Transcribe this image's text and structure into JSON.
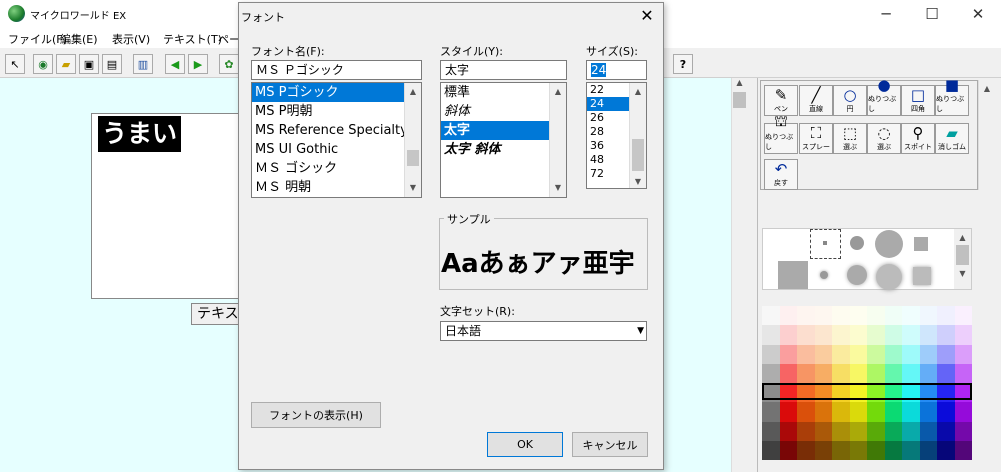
{
  "app": {
    "title": "マイクロワールド EX",
    "window_controls": {
      "minimize": "─",
      "maximize": "☐",
      "close": "✕"
    },
    "menus": [
      "ファイル(F)",
      "編集(E)",
      "表示(V)",
      "テキスト(T)",
      "ペー"
    ]
  },
  "canvas": {
    "selected_text": "うまい",
    "text_button": "テキス"
  },
  "toolbar": {
    "icons": [
      "pointer-icon",
      "globe-icon",
      "open-folder-icon",
      "save-icon",
      "print-icon",
      "book-icon",
      "prev-page-icon",
      "next-page-icon",
      "turtle-icon",
      "help-icon"
    ],
    "help_label": "?"
  },
  "paint_tools": [
    {
      "label": "ペン",
      "icon": "pen-icon"
    },
    {
      "label": "直線",
      "icon": "line-icon"
    },
    {
      "label": "円",
      "icon": "circle-icon"
    },
    {
      "label": "ぬりつぶし",
      "icon": "filled-circle-icon"
    },
    {
      "label": "四角",
      "icon": "rectangle-icon"
    },
    {
      "label": "ぬりつぶし",
      "icon": "filled-rectangle-icon"
    },
    {
      "label": "ぬりつぶし",
      "icon": "bucket-icon"
    },
    {
      "label": "スプレー",
      "icon": "spray-icon"
    },
    {
      "label": "選ぶ",
      "icon": "select-rect-icon"
    },
    {
      "label": "選ぶ",
      "icon": "lasso-icon"
    },
    {
      "label": "スポイト",
      "icon": "eyedropper-icon"
    },
    {
      "label": "消しゴム",
      "icon": "eraser-icon"
    },
    {
      "label": "戻す",
      "icon": "undo-icon"
    }
  ],
  "dialog": {
    "title": "フォント",
    "close": "✕",
    "font_name": {
      "label": "フォント名(F):",
      "value": "ＭＳ Ｐゴシック",
      "items": [
        "MS Pゴシック",
        "MS P明朝",
        "MS Reference Specialty",
        "MS UI Gothic",
        "ＭＳ ゴシック",
        "ＭＳ 明朝"
      ],
      "selected_index": 0
    },
    "style": {
      "label": "スタイル(Y):",
      "value": "太字",
      "items": [
        "標準",
        "斜体",
        "太字",
        "太字 斜体"
      ],
      "selected_index": 2
    },
    "size": {
      "label": "サイズ(S):",
      "value": "24",
      "items": [
        "22",
        "24",
        "26",
        "28",
        "36",
        "48",
        "72"
      ],
      "selected_index": 1
    },
    "sample": {
      "label": "サンプル",
      "text": "Aaあぁアァ亜宇"
    },
    "charset": {
      "label": "文字セット(R):",
      "value": "日本語"
    },
    "show_fonts_button": "フォントの表示(H)",
    "ok_button": "OK",
    "cancel_button": "キャンセル"
  }
}
